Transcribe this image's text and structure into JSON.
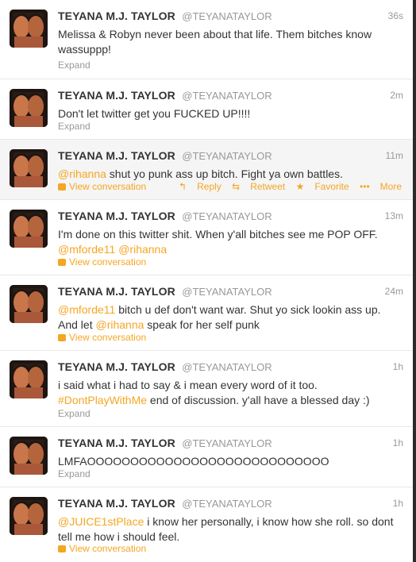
{
  "colors": {
    "link": "#f5a623",
    "name": "#333333",
    "meta": "#999999"
  },
  "tweets": [
    {
      "name": "TEYANA M.J. TAYLOR",
      "handle": "@TEYANATAYLOR",
      "time": "36s",
      "text": "Melissa & Robyn never been about that life. Them bitches know wassuppp!",
      "footer": "Expand"
    },
    {
      "name": "TEYANA M.J. TAYLOR",
      "handle": "@TEYANATAYLOR",
      "time": "2m",
      "text": "Don't let twitter get you FUCKED UP!!!!",
      "footer": "Expand"
    },
    {
      "name": "TEYANA M.J. TAYLOR",
      "handle": "@TEYANATAYLOR",
      "time": "11m",
      "mention": "@rihanna",
      "text": " shut yo punk ass up bitch. Fight ya own battles.",
      "footer": "View conversation",
      "actions": {
        "reply": "Reply",
        "retweet": "Retweet",
        "favorite": "Favorite",
        "more": "More"
      }
    },
    {
      "name": "TEYANA M.J. TAYLOR",
      "handle": "@TEYANATAYLOR",
      "time": "13m",
      "text": "I'm done on this twitter shit. When y'all bitches see me POP OFF.",
      "mention1": "@mforde11",
      "mention2": "@rihanna",
      "footer": "View conversation"
    },
    {
      "name": "TEYANA M.J. TAYLOR",
      "handle": "@TEYANATAYLOR",
      "time": "24m",
      "mention1": "@mforde11",
      "text1": " bitch u def don't want war. Shut yo sick lookin ass up. And let ",
      "mention2": "@rihanna",
      "text2": " speak for her self punk",
      "footer": "View conversation"
    },
    {
      "name": "TEYANA M.J. TAYLOR",
      "handle": "@TEYANATAYLOR",
      "time": "1h",
      "text1": "i said what i had to say & i mean every word of it too.",
      "hashtag": "#DontPlayWithMe",
      "text2": " end of discussion. y'all have a blessed day :)",
      "footer": "Expand"
    },
    {
      "name": "TEYANA M.J. TAYLOR",
      "handle": "@TEYANATAYLOR",
      "time": "1h",
      "text": "LMFAOOOOOOOOOOOOOOOOOOOOOOOOOOOO",
      "footer": "Expand"
    },
    {
      "name": "TEYANA M.J. TAYLOR",
      "handle": "@TEYANATAYLOR",
      "time": "1h",
      "mention": "@JUICE1stPlace",
      "text": " i know her personally, i know how she roll. so dont tell me how i should feel.",
      "footer": "View conversation"
    }
  ]
}
